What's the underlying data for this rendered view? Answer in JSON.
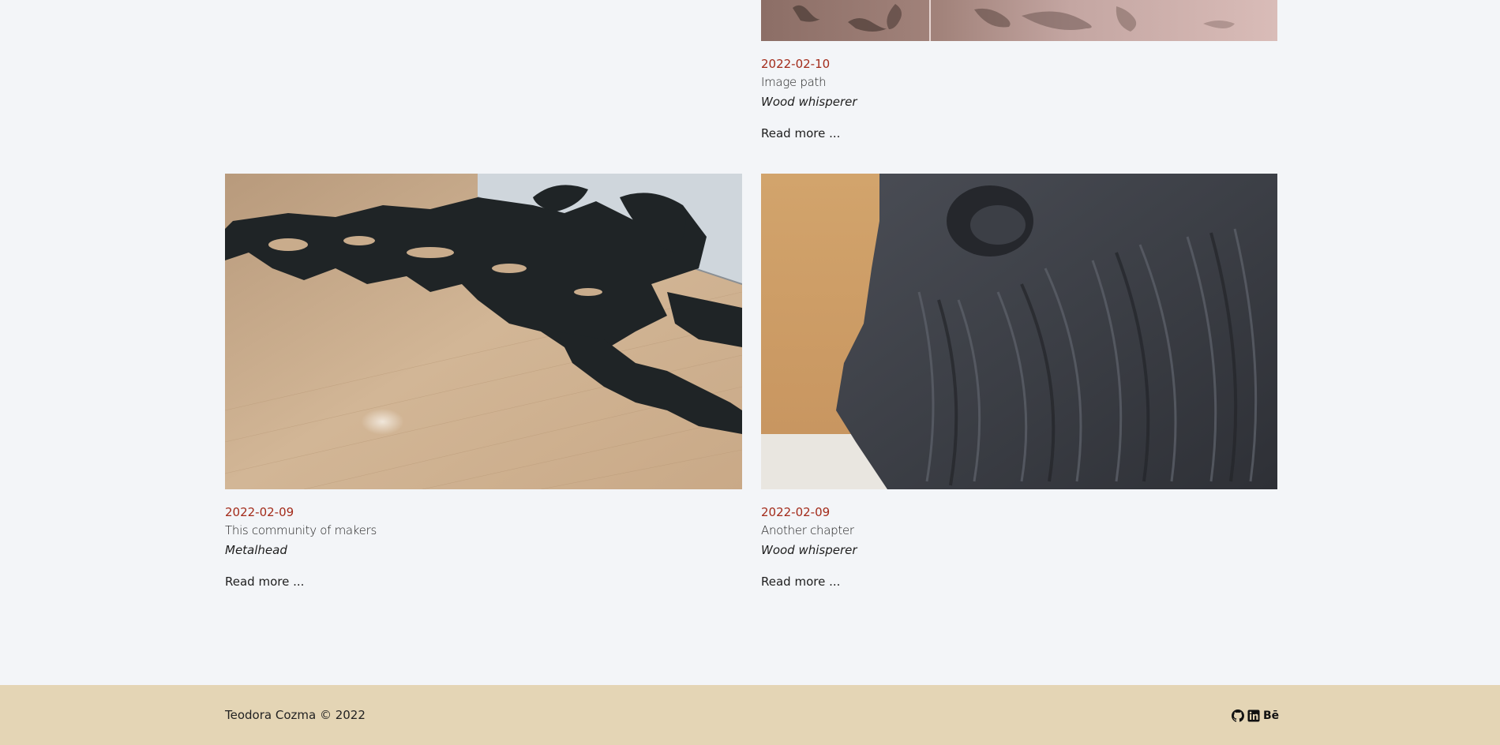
{
  "posts": [
    {
      "date": "2022-02-10",
      "title": "Image path",
      "category": "Wood whisperer",
      "read_more": "Read more ..."
    },
    {
      "date": "2022-02-09",
      "title": "This community of makers",
      "category": "Metalhead",
      "read_more": "Read more ..."
    },
    {
      "date": "2022-02-09",
      "title": "Another chapter",
      "category": "Wood whisperer",
      "read_more": "Read more ..."
    }
  ],
  "footer": {
    "copyright": "Teodora Cozma © 2022",
    "social_icons": [
      "github-icon",
      "linkedin-icon",
      "behance-icon"
    ],
    "behance_label": "Bē"
  },
  "colors": {
    "background": "#f3f5f8",
    "date": "#a32b1a",
    "footer": "#e4d5b5"
  }
}
